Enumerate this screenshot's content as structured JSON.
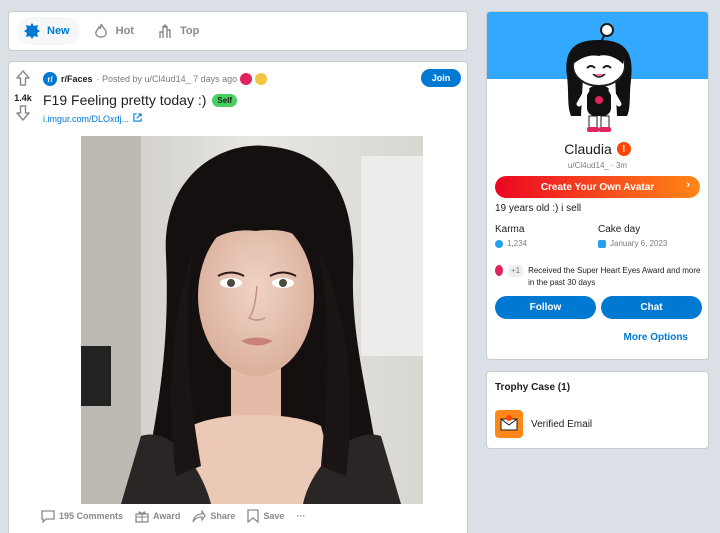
{
  "sort": {
    "new_label": "New",
    "hot_label": "Hot",
    "top_label": "Top"
  },
  "post": {
    "vote_count": "1.4k",
    "subreddit": "r/Faces",
    "subreddit_icon": "r/",
    "meta": "· Posted by u/Cl4ud14_ 7 days ago",
    "join_label": "Join",
    "title": "F19 Feeling pretty today :)",
    "flair": "Self",
    "link": "i.imgur.com/DLOxdj...",
    "comments_label": "195 Comments",
    "award_label": "Award",
    "share_label": "Share",
    "save_label": "Save",
    "more_label": "···"
  },
  "profile": {
    "name": "Claudia",
    "username": "u/Cl4ud14_ · 3m",
    "create_avatar_label": "Create Your Own Avatar",
    "bio": "19 years old :) i sell",
    "karma_label": "Karma",
    "karma_value": "1,234",
    "cakeday_label": "Cake day",
    "cakeday_value": "January 6, 2023",
    "award_count": "+1",
    "award_text": "Received the Super Heart Eyes Award and more in the past 30 days",
    "follow_label": "Follow",
    "chat_label": "Chat",
    "more_options_label": "More Options"
  },
  "trophy_case": {
    "title": "Trophy Case (1)",
    "items": [
      {
        "label": "Verified Email",
        "icon": "verified-email-trophy-icon"
      }
    ]
  },
  "colors": {
    "accent": "#0079d3",
    "banner": "#33a8ff",
    "flair": "#46d160",
    "create_gradient_start": "#ec0623",
    "create_gradient_end": "#ff8717"
  }
}
